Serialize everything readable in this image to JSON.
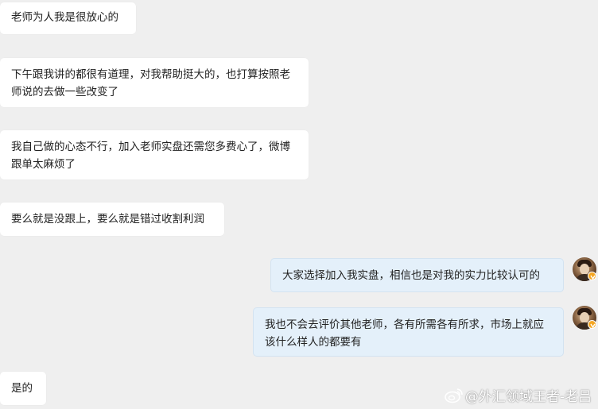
{
  "messages": [
    {
      "side": "left",
      "text": "老师为人我是很放心的"
    },
    {
      "side": "left",
      "text": "下午跟我讲的都很有道理，对我帮助挺大的，也打算按照老师说的去做一些改变了"
    },
    {
      "side": "left",
      "text": "我自己做的心态不行，加入老师实盘还需您多费心了，微博跟单太麻烦了"
    },
    {
      "side": "left",
      "text": "要么就是没跟上，要么就是错过收割利润"
    },
    {
      "side": "right",
      "text": "大家选择加入我实盘，相信也是对我的实力比较认可的"
    },
    {
      "side": "right",
      "text": "我也不会去评价其他老师，各有所需各有所求，市场上就应该什么样人的都要有"
    },
    {
      "side": "left",
      "text": "是的"
    }
  ],
  "watermark": {
    "text": "@外汇领域王者-老吕",
    "icon": "weibo-icon"
  },
  "avatar_badge": {
    "icon": "verified-badge-icon",
    "color": "#f5a623"
  }
}
